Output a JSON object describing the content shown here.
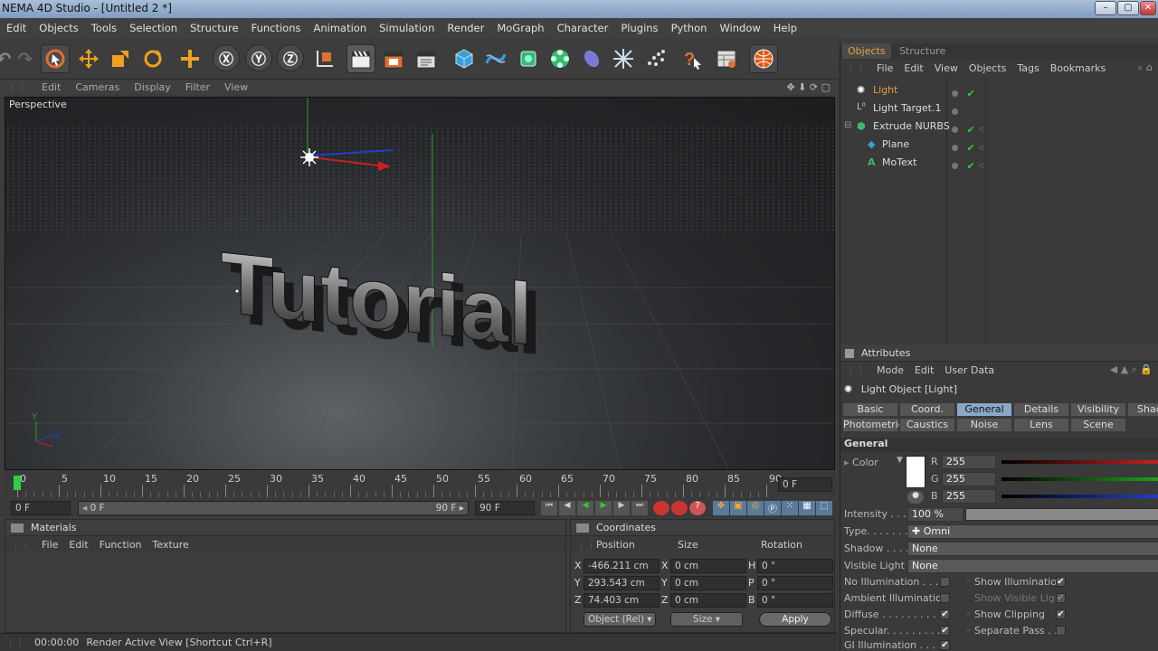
{
  "window": {
    "title": "NEMA 4D Studio - [Untitled 2 *]",
    "min": "–",
    "max": "▢",
    "close": "✕"
  },
  "menu": [
    "Edit",
    "Objects",
    "Tools",
    "Selection",
    "Structure",
    "Functions",
    "Animation",
    "Simulation",
    "Render",
    "MoGraph",
    "Character",
    "Plugins",
    "Python",
    "Window",
    "Help"
  ],
  "viewport": {
    "menu": [
      "Edit",
      "Cameras",
      "Display",
      "Filter",
      "View"
    ],
    "label": "Perspective",
    "text3d": "Tutorial",
    "axis_y": "Y",
    "axis_z": "Z"
  },
  "timeline": {
    "ticks": [
      "0",
      "5",
      "10",
      "15",
      "20",
      "25",
      "30",
      "35",
      "40",
      "45",
      "50",
      "55",
      "60",
      "65",
      "70",
      "75",
      "80",
      "85",
      "90"
    ],
    "current": "0 F",
    "start": "0 F",
    "range_left": "0 F",
    "range_right": "90 F",
    "end": "90 F"
  },
  "materials": {
    "title": "Materials",
    "menu": [
      "File",
      "Edit",
      "Function",
      "Texture"
    ]
  },
  "coordinates": {
    "title": "Coordinates",
    "headers": [
      "Position",
      "Size",
      "Rotation"
    ],
    "rows": [
      {
        "axis": "X",
        "pos": "-466.211 cm",
        "saxis": "X",
        "size": "0 cm",
        "raxis": "H",
        "rot": "0 °"
      },
      {
        "axis": "Y",
        "pos": "293.543 cm",
        "saxis": "Y",
        "size": "0 cm",
        "raxis": "P",
        "rot": "0 °"
      },
      {
        "axis": "Z",
        "pos": "74.403 cm",
        "saxis": "Z",
        "size": "0 cm",
        "raxis": "B",
        "rot": "0 °"
      }
    ],
    "mode": "Object (Rel)",
    "size_mode": "Size",
    "apply": "Apply"
  },
  "status": {
    "time": "00:00:00",
    "message": "Render Active View [Shortcut Ctrl+R]"
  },
  "objects": {
    "tabs": [
      "Objects",
      "Structure"
    ],
    "menu": [
      "File",
      "Edit",
      "View",
      "Objects",
      "Tags",
      "Bookmarks"
    ],
    "items": [
      {
        "name": "Light",
        "icon": "light-icon",
        "selected": true
      },
      {
        "name": "Light Target.1",
        "icon": "target-icon"
      },
      {
        "name": "Extrude NURBS",
        "icon": "extrude-icon"
      },
      {
        "name": "Plane",
        "icon": "plane-icon"
      },
      {
        "name": "MoText",
        "icon": "motext-icon"
      }
    ]
  },
  "attributes": {
    "title": "Attributes",
    "menu": [
      "Mode",
      "Edit",
      "User Data"
    ],
    "object_label": "Light Object [Light]",
    "tabs_row1": [
      "Basic",
      "Coord.",
      "General",
      "Details",
      "Visibility",
      "Shad"
    ],
    "tabs_row2": [
      "Photometric",
      "Caustics",
      "Noise",
      "Lens",
      "Scene"
    ],
    "active_tab": "General",
    "section": "General",
    "color_label": "Color",
    "r_label": "R",
    "r": "255",
    "g_label": "G",
    "g": "255",
    "b_label": "B",
    "b": "255",
    "intensity_label": "Intensity . . .",
    "intensity": "100 %",
    "intensity_fraction": 1.0,
    "type_label": "Type. . . . . . .",
    "type": "Omni",
    "shadow_label": "Shadow . . . .",
    "shadow": "None",
    "visible_label": "Visible Light",
    "visible": "None",
    "checks_left": [
      {
        "label": "No Illumination . . . .",
        "checked": false
      },
      {
        "label": "Ambient Illumination",
        "checked": false
      },
      {
        "label": "Diffuse . . . . . . . . . .",
        "checked": true
      },
      {
        "label": "Specular. . . . . . . . .",
        "checked": true
      },
      {
        "label": "GI Illumination . . . .",
        "checked": true
      }
    ],
    "checks_right": [
      {
        "label": "Show Illumination",
        "checked": true
      },
      {
        "label": "Show Visible Light",
        "checked": true
      },
      {
        "label": "Show Clipping",
        "checked": true
      },
      {
        "label": "Separate Pass . .",
        "checked": false
      }
    ]
  },
  "colors": {
    "accent": "#e8a23a",
    "selected_tab": "#8aa8c8",
    "red": "#c82020",
    "green": "#20a020",
    "blue": "#2040c8"
  }
}
